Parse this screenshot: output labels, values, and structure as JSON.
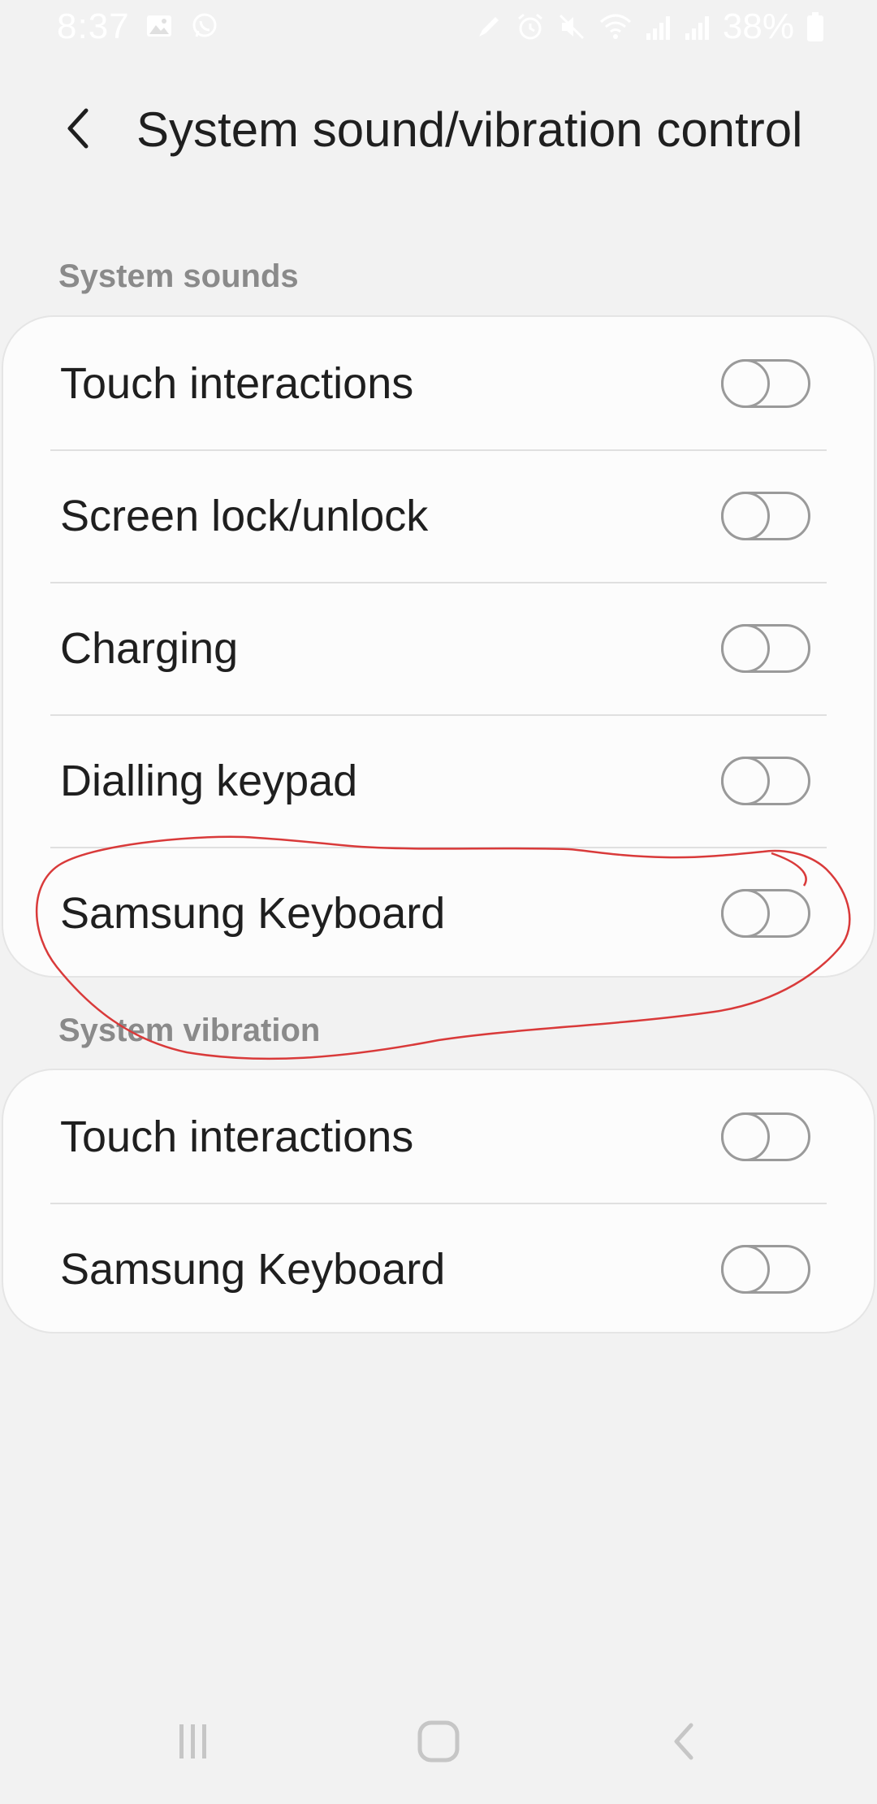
{
  "status_bar": {
    "time": "8:37",
    "battery": "38%",
    "icons": [
      "gallery-icon",
      "whatsapp-icon",
      "edit-icon",
      "alarm-icon",
      "mute-icon",
      "wifi-icon",
      "signal-icon",
      "signal-icon",
      "battery-icon"
    ]
  },
  "header": {
    "title": "System sound/vibration control",
    "back_icon": "chevron-left-icon"
  },
  "sections": [
    {
      "label": "System sounds",
      "items": [
        {
          "label": "Touch interactions",
          "enabled": false
        },
        {
          "label": "Screen lock/unlock",
          "enabled": false
        },
        {
          "label": "Charging",
          "enabled": false
        },
        {
          "label": "Dialling keypad",
          "enabled": false
        },
        {
          "label": "Samsung Keyboard",
          "enabled": false
        }
      ]
    },
    {
      "label": "System vibration",
      "items": [
        {
          "label": "Touch interactions",
          "enabled": false
        },
        {
          "label": "Samsung Keyboard",
          "enabled": false
        }
      ]
    }
  ],
  "annotation_color": "#d93a3a",
  "nav_bar": {
    "buttons": [
      "recent-apps-icon",
      "home-icon",
      "back-icon"
    ]
  }
}
